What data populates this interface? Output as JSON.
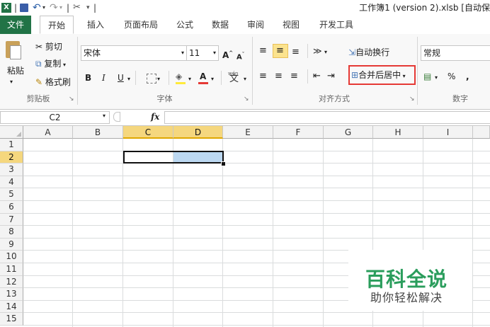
{
  "quick_access": {
    "customize_label": "▾"
  },
  "window": {
    "title": "工作簿1 (version 2).xlsb [自动保"
  },
  "tabs": [
    "文件",
    "开始",
    "插入",
    "页面布局",
    "公式",
    "数据",
    "审阅",
    "视图",
    "开发工具"
  ],
  "clipboard": {
    "paste": "粘贴",
    "cut": "剪切",
    "copy": "复制",
    "format_painter": "格式刷",
    "label": "剪贴板"
  },
  "font": {
    "name": "宋体",
    "size": "11",
    "bold": "B",
    "italic": "I",
    "underline": "U",
    "label": "字体",
    "phonetic": "wén"
  },
  "alignment": {
    "wrap_text": "自动换行",
    "merge_center": "合并后居中",
    "label": "对齐方式"
  },
  "number": {
    "format": "常规",
    "percent": "%",
    "comma": ",",
    "label": "数字"
  },
  "formula_bar": {
    "name_box": "C2",
    "fx": "fx"
  },
  "columns": [
    "A",
    "B",
    "C",
    "D",
    "E",
    "F",
    "G",
    "H",
    "I"
  ],
  "rows": [
    "1",
    "2",
    "3",
    "4",
    "5",
    "6",
    "7",
    "8",
    "9",
    "10",
    "11",
    "12",
    "13",
    "14",
    "15"
  ],
  "watermark": {
    "title": "百科全说",
    "subtitle": "助你轻松解决"
  },
  "colors": {
    "accent": "#217346",
    "highlight": "#e53935",
    "selected_header": "#f5d77e",
    "selection_fill": "#bcd8f1"
  }
}
